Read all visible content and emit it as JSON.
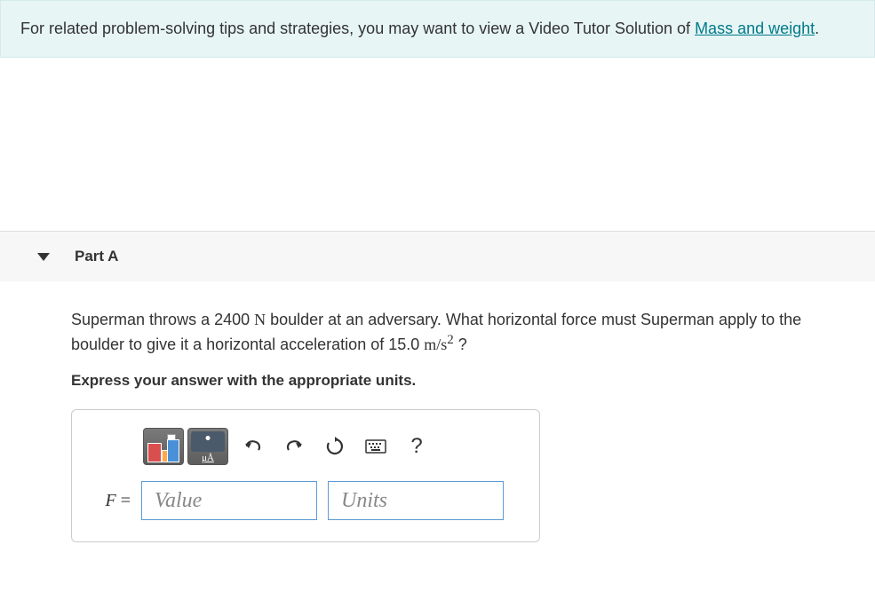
{
  "banner": {
    "prefix": "For related problem-solving tips and strategies, you may want to view a Video Tutor Solution of ",
    "link_text": "Mass and weight",
    "suffix": "."
  },
  "part": {
    "label": "Part A"
  },
  "question": {
    "text1": "Superman throws a 2400 ",
    "unit1": "N",
    "text2": " boulder at an adversary. What horizontal force must Superman apply to the boulder to give it a horizontal acceleration of 15.0 ",
    "unit2": "m/s",
    "exp": "2",
    "text3": " ?"
  },
  "instruction": "Express your answer with the appropriate units.",
  "toolbar": {
    "chem_label": "μÅ"
  },
  "answer": {
    "variable": "F",
    "equals": " = ",
    "value_placeholder": "Value",
    "units_placeholder": "Units"
  }
}
